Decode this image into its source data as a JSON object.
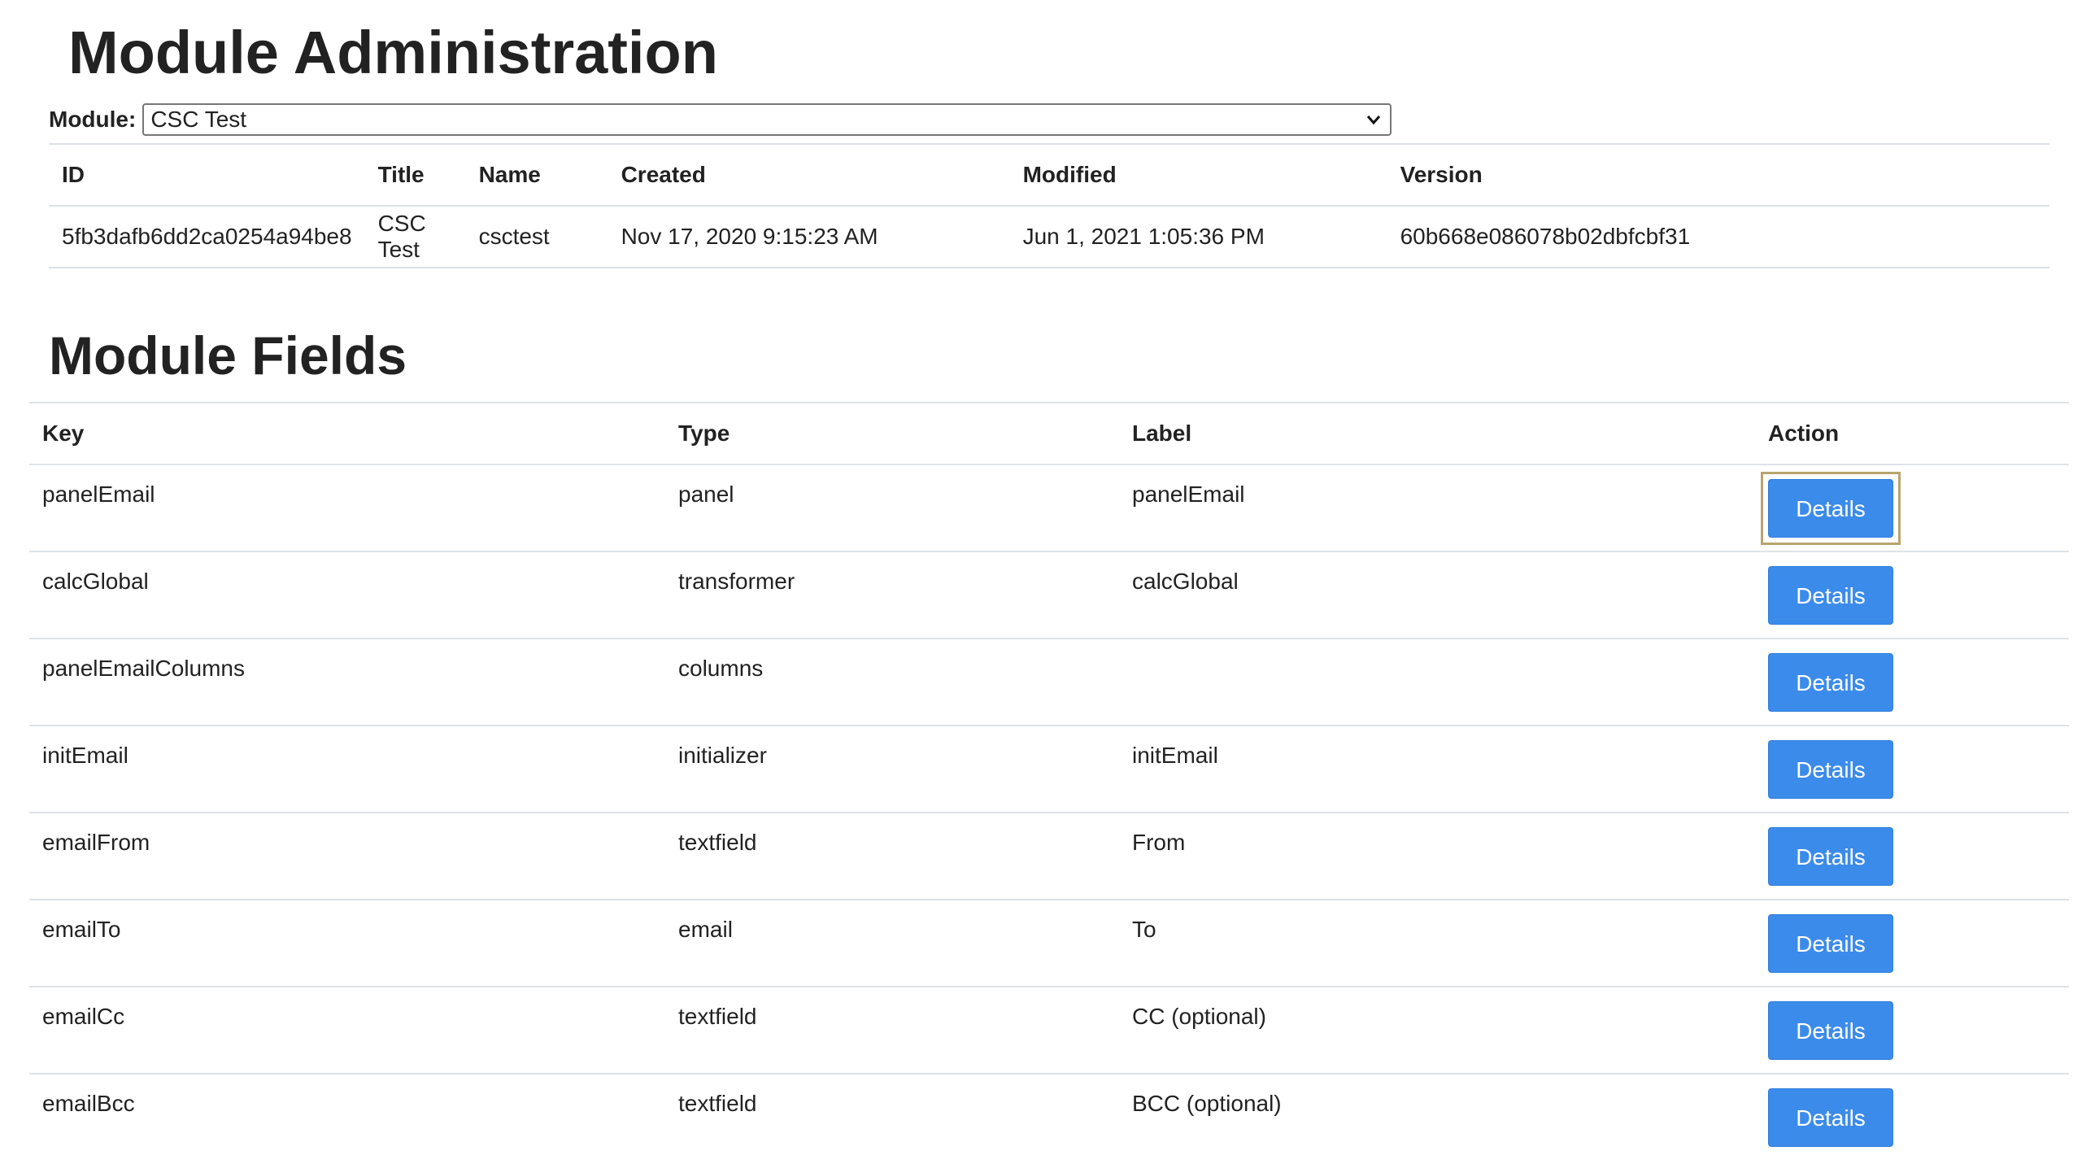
{
  "header": {
    "title": "Module Administration"
  },
  "module_select": {
    "label": "Module:",
    "selected": "CSC Test"
  },
  "module_info": {
    "columns": [
      "ID",
      "Title",
      "Name",
      "Created",
      "Modified",
      "Version"
    ],
    "row": {
      "id": "5fb3dafb6dd2ca0254a94be8",
      "title": "CSC Test",
      "name": "csctest",
      "created": "Nov 17, 2020 9:15:23 AM",
      "modified": "Jun 1, 2021 1:05:36 PM",
      "version": "60b668e086078b02dbfcbf31"
    }
  },
  "fields_section": {
    "title": "Module Fields",
    "columns": [
      "Key",
      "Type",
      "Label",
      "Action"
    ],
    "button_label": "Details",
    "rows": [
      {
        "key": "panelEmail",
        "type": "panel",
        "label": "panelEmail",
        "focused": true
      },
      {
        "key": "calcGlobal",
        "type": "transformer",
        "label": "calcGlobal"
      },
      {
        "key": "panelEmailColumns",
        "type": "columns",
        "label": ""
      },
      {
        "key": "initEmail",
        "type": "initializer",
        "label": "initEmail"
      },
      {
        "key": "emailFrom",
        "type": "textfield",
        "label": "From"
      },
      {
        "key": "emailTo",
        "type": "email",
        "label": "To"
      },
      {
        "key": "emailCc",
        "type": "textfield",
        "label": "CC (optional)"
      },
      {
        "key": "emailBcc",
        "type": "textfield",
        "label": "BCC (optional)"
      }
    ]
  },
  "colors": {
    "button_bg": "#3b8beb",
    "button_text": "#ffffff",
    "focus_ring": "#b8a46e",
    "row_border": "#dee2e6"
  }
}
